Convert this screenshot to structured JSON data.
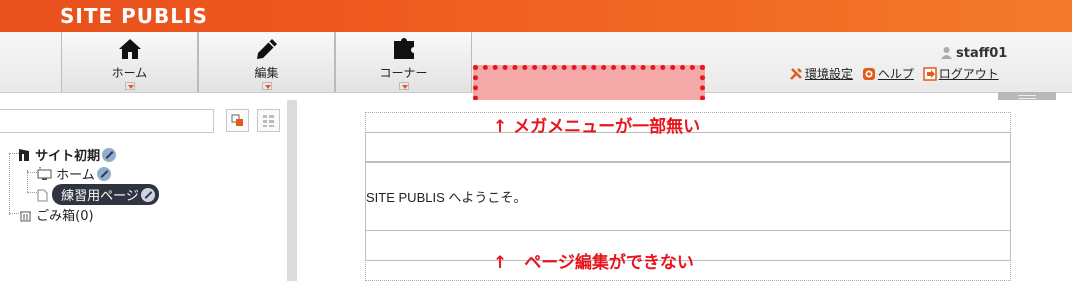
{
  "header": {
    "brand": "SITE PUBLIS"
  },
  "nav": {
    "items": [
      {
        "label": "ホーム",
        "icon": "home-icon"
      },
      {
        "label": "編集",
        "icon": "pencil-icon"
      },
      {
        "label": "コーナー",
        "icon": "puzzle-icon"
      }
    ]
  },
  "user": {
    "name": "staff01",
    "links": {
      "settings": "環境設定",
      "help": "ヘルプ",
      "logout": "ログアウト"
    }
  },
  "search": {
    "placeholder": ""
  },
  "tree": {
    "root": "サイト初期",
    "home": "ホーム",
    "practice_page": "練習用ページ",
    "trash": "ごみ箱(0)"
  },
  "content": {
    "welcome": "SITE PUBLIS へようこそ。",
    "note_top": "↑ メガメニューが一部無い",
    "note_bottom": "↑　ページ編集ができない"
  },
  "colors": {
    "brand": "#ef5a1f",
    "annotation": "#e8161c",
    "highlight_fill": "#f4a8a8"
  }
}
